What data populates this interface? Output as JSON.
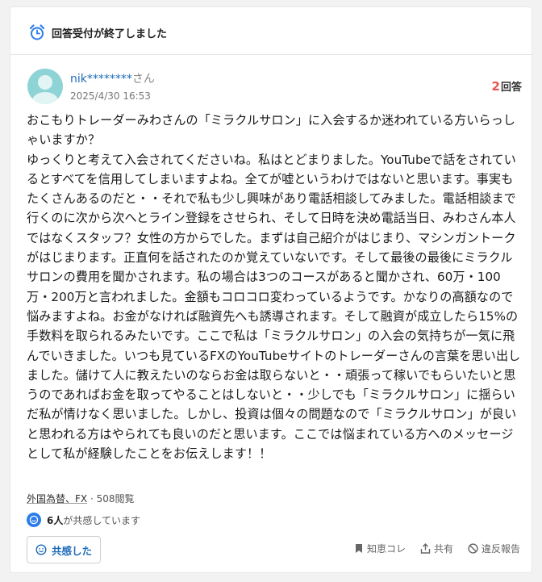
{
  "banner": {
    "title": "回答受付が終了しました",
    "icon": "alarm-clock-icon"
  },
  "question": {
    "user_name": "nik********",
    "user_suffix": "さん",
    "date": "2025/4/30 16:53",
    "answer_count": "2",
    "answer_label": "回答",
    "body": "おこもりトレーダーみわさんの「ミラクルサロン」に入会するか迷われている方いらっしゃいますか？\nゆっくりと考えて入会されてくださいね。私はとどまりました。YouTubeで話をされているとすべてを信用してしまいますよね。全てが嘘というわけではないと思います。事実もたくさんあるのだと・・それで私も少し興味があり電話相談してみました。電話相談まで行くのに次から次へとライン登録をさせられ、そして日時を決め電話当日、みわさん本人ではなくスタッフ？女性の方からでした。まずは自己紹介がはじまり、マシンガントークがはじまります。正直何を話されたのか覚えていないです。そして最後の最後にミラクルサロンの費用を聞かされます。私の場合は3つのコースがあると聞かされ、60万・100万・200万と言われました。金額もコロコロ変わっているようです。かなりの高額なので悩みますよね。お金がなければ融資先へも誘導されます。そして融資が成立したら15%の手数料を取られるみたいです。ここで私は「ミラクルサロン」の入会の気持ちが一気に飛んでいきました。いつも見ているFXのYouTubeサイトのトレーダーさんの言葉を思い出しました。儲けて人に教えたいのならお金は取らないと・・頑張って稼いでもらいたいと思うのであればお金を取ってやることはしないと・・少しでも「ミラクルサロン」に揺らいだ私が情けなく思いました。しかし、投資は個々の問題なので「ミラクルサロン」が良いと思われる方はやられても良いのだと思います。ここでは悩まれている方へのメッセージとして私が経験したことをお伝えします！！",
    "category": "外国為替、FX",
    "views": "508閲覧",
    "empathy_count": "6人",
    "empathy_text": "が共感しています"
  },
  "actions": {
    "kyokan_button": "共感した",
    "chiebukuro": "知恵コレ",
    "share": "共有",
    "report": "違反報告"
  },
  "colors": {
    "link": "#1e6bb8",
    "accent": "#e8554e",
    "primary_blue": "#2b7de9"
  }
}
